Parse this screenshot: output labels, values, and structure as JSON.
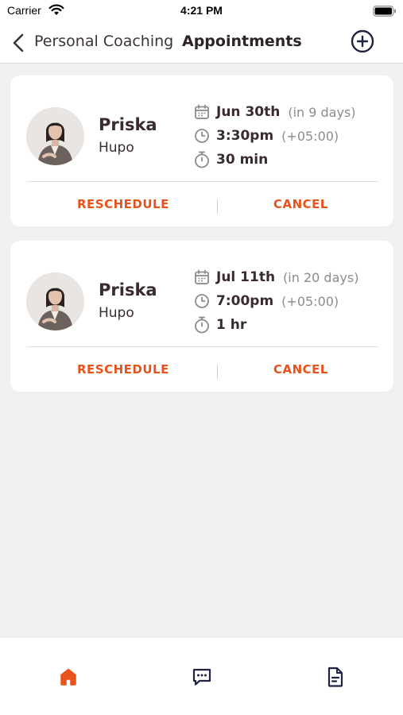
{
  "status_bar": {
    "carrier": "Carrier",
    "time": "4:21 PM"
  },
  "nav": {
    "back_label": "Personal Coaching",
    "title": "Appointments",
    "add_icon": "plus-circle-icon"
  },
  "appointments": [
    {
      "first_name": "Priska",
      "last_name": "Hupo",
      "date": "Jun 30th",
      "relative": "(in 9 days)",
      "time": "3:30pm",
      "timezone": "(+05:00)",
      "duration": "30 min",
      "reschedule_label": "RESCHEDULE",
      "cancel_label": "CANCEL"
    },
    {
      "first_name": "Priska",
      "last_name": "Hupo",
      "date": "Jul 11th",
      "relative": "(in 20 days)",
      "time": "7:00pm",
      "timezone": "(+05:00)",
      "duration": "1 hr",
      "reschedule_label": "RESCHEDULE",
      "cancel_label": "CANCEL"
    }
  ],
  "tab_bar": {
    "tabs": [
      {
        "icon": "home-icon",
        "active": true
      },
      {
        "icon": "message-icon",
        "active": false
      },
      {
        "icon": "document-icon",
        "active": false
      }
    ]
  },
  "colors": {
    "accent": "#e8531c",
    "text_dark": "#3a2b2e",
    "text_muted": "#8f8a8c",
    "background": "#f0f0f0",
    "navy_icon": "#1f2340"
  }
}
